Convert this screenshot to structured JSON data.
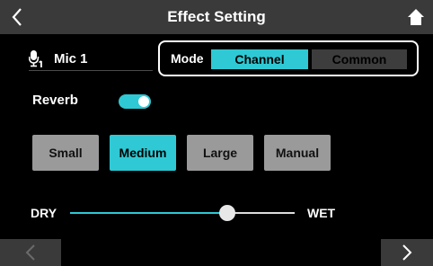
{
  "header": {
    "title": "Effect Setting",
    "back_icon": "chevron-left-icon",
    "home_icon": "home-icon"
  },
  "mic": {
    "icon": "microphone-icon",
    "label": "Mic 1"
  },
  "mode": {
    "label": "Mode",
    "options": [
      "Channel",
      "Common"
    ],
    "selected": "Channel"
  },
  "reverb": {
    "label": "Reverb",
    "enabled": true
  },
  "presets": {
    "options": [
      "Small",
      "Medium",
      "Large",
      "Manual"
    ],
    "selected": "Medium"
  },
  "mix": {
    "dry_label": "DRY",
    "wet_label": "WET",
    "level": 0.7
  },
  "nav": {
    "prev_icon": "chevron-left-icon",
    "next_icon": "chevron-right-icon"
  },
  "colors": {
    "accent": "#2ec9d4",
    "button_gray": "#9a9a9a",
    "bar_gray": "#3a3a3a",
    "background": "#000000"
  }
}
